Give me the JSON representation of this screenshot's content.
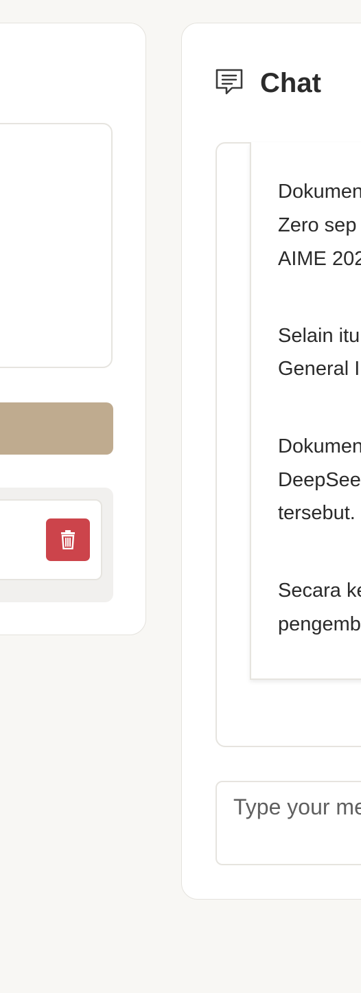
{
  "chat": {
    "title": "Chat",
    "messages": [
      "Dokumen",
      "Zero sep",
      "AIME 202",
      "Selain itu",
      "General I",
      "Dokumen",
      "DeepSee",
      "tersebut.",
      "Secara ke",
      "pengemb"
    ],
    "input_placeholder": "Type your me"
  },
  "colors": {
    "accent_button": "#bfab8f",
    "delete_button": "#cc444b"
  },
  "icons": {
    "chat_header": "chat-bubble-icon",
    "delete": "trash-icon"
  }
}
